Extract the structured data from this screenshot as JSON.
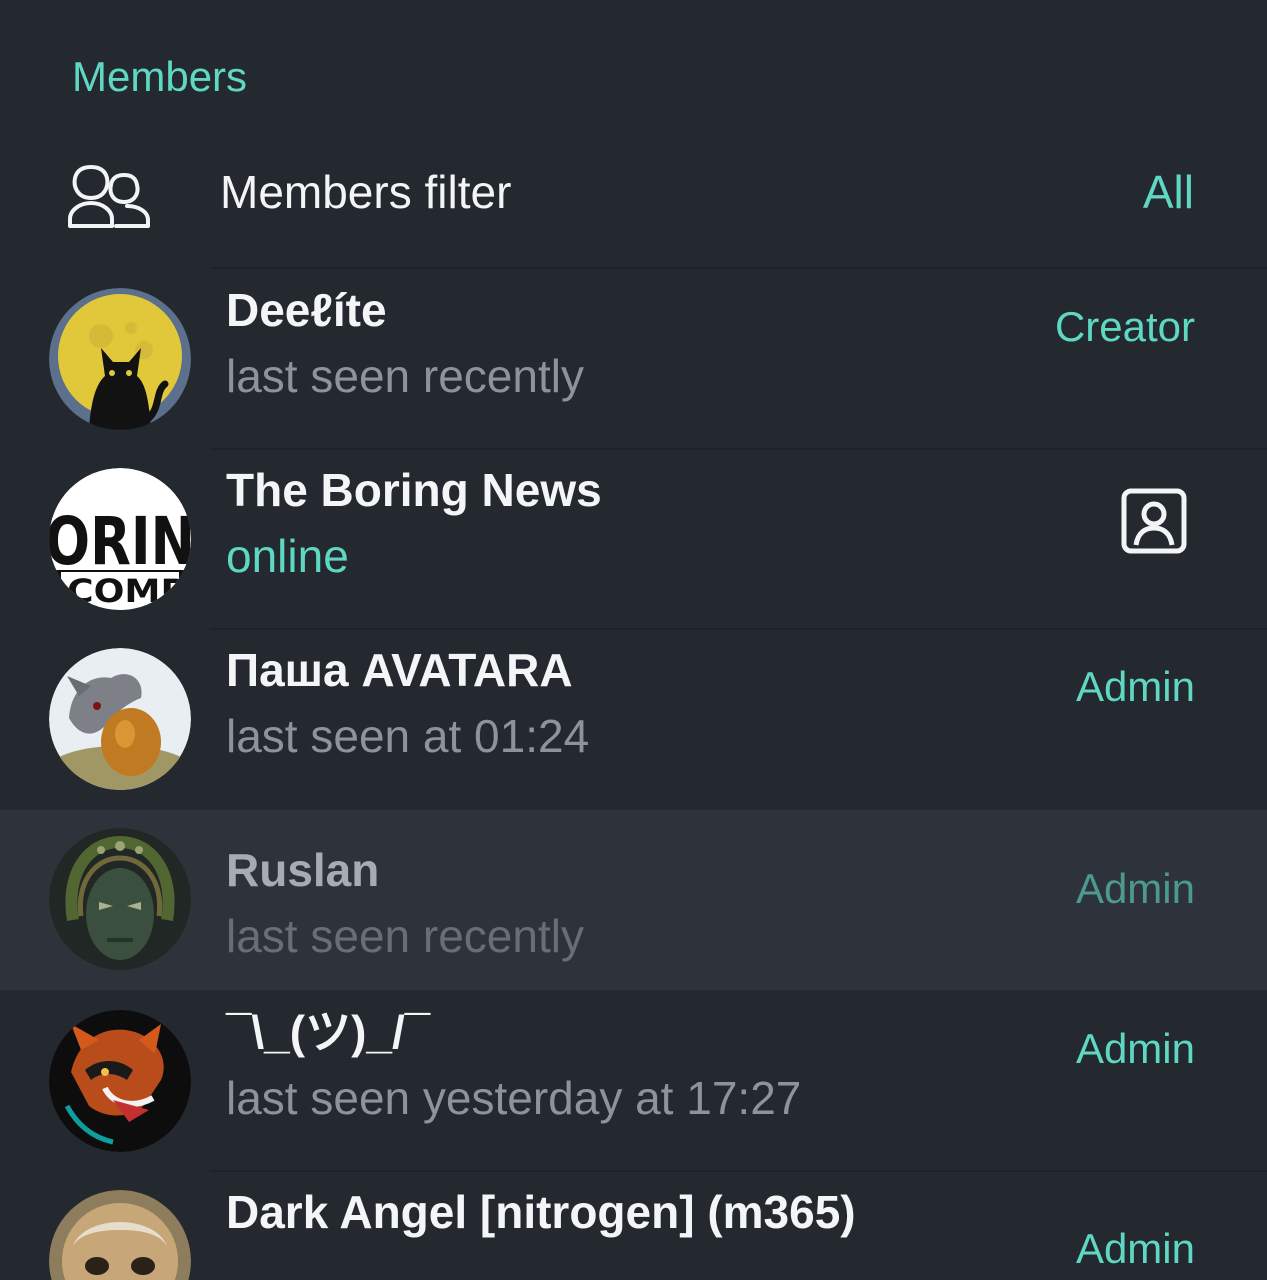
{
  "section": {
    "title": "Members"
  },
  "filter": {
    "label": "Members filter",
    "value": "All",
    "icon": "group-icon"
  },
  "members": [
    {
      "name": "Deeℓíte",
      "status": "last seen recently",
      "role": "Creator",
      "avatar": "moon-cat-avatar"
    },
    {
      "name": "The Boring News",
      "status": "online",
      "role": "",
      "avatar": "boring-news-logo-avatar",
      "trailing_icon": "contact-card-icon",
      "status_color": "#5fd8c3"
    },
    {
      "name": "Паша AVATARA",
      "status": "last seen at 01:24",
      "role": "Admin",
      "avatar": "egg-creature-avatar"
    },
    {
      "name": "Ruslan",
      "status": "last seen recently",
      "role": "Admin",
      "avatar": "green-mask-avatar"
    },
    {
      "name": "¯\\_(ツ)_/¯",
      "status": "last seen yesterday at 17:27",
      "role": "Admin",
      "avatar": "raccoon-avatar"
    },
    {
      "name": "Dark Angel [nitrogen] (m365)",
      "status": "",
      "role": "Admin",
      "avatar": "cat-avatar"
    }
  ],
  "colors": {
    "background": "#24282f",
    "accent": "#5fd8c3",
    "text": "#f4f5f7",
    "muted": "#8d939b",
    "highlight": "#2e333b"
  }
}
